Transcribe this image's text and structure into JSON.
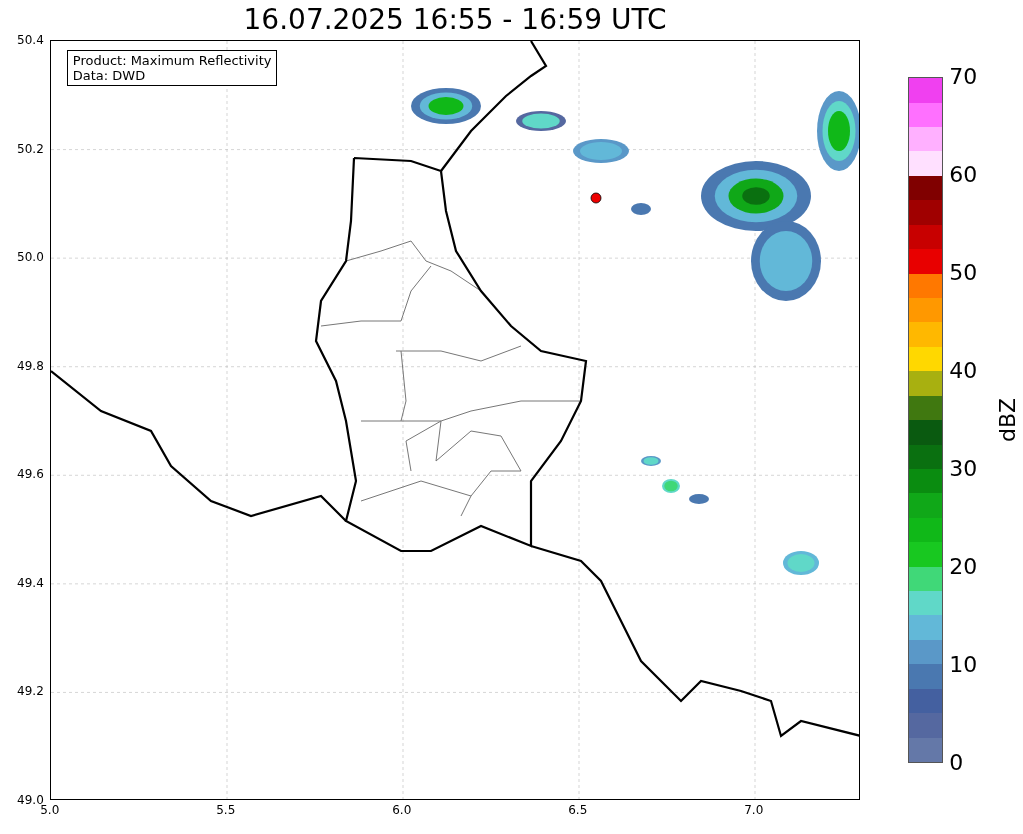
{
  "title": "16.07.2025 16:55 - 16:59 UTC",
  "info_box": [
    "Product: Maximum Reflectivity",
    "Data: DWD"
  ],
  "x_ticks": [
    "5.0",
    "5.5",
    "6.0",
    "6.5",
    "7.0"
  ],
  "y_ticks": [
    "50.4",
    "50.2",
    "50.0",
    "49.8",
    "49.6",
    "49.4",
    "49.2",
    "49.0"
  ],
  "colorbar": {
    "label": "dBZ",
    "ticks": [
      "70",
      "60",
      "50",
      "40",
      "30",
      "20",
      "10",
      "0"
    ],
    "bands": [
      {
        "color": "#6478a8"
      },
      {
        "color": "#5568a0"
      },
      {
        "color": "#4460a0"
      },
      {
        "color": "#4a78b0"
      },
      {
        "color": "#5a98c8"
      },
      {
        "color": "#62b8d8"
      },
      {
        "color": "#60d8c8"
      },
      {
        "color": "#40d878"
      },
      {
        "color": "#18c820"
      },
      {
        "color": "#10b818"
      },
      {
        "color": "#10a818"
      },
      {
        "color": "#0a8c10"
      },
      {
        "color": "#0a7010"
      },
      {
        "color": "#0a5a10"
      },
      {
        "color": "#407810"
      },
      {
        "color": "#a8b010"
      },
      {
        "color": "#ffd800"
      },
      {
        "color": "#ffb800"
      },
      {
        "color": "#ff9800"
      },
      {
        "color": "#ff7800"
      },
      {
        "color": "#e80000"
      },
      {
        "color": "#c80000"
      },
      {
        "color": "#a00000"
      },
      {
        "color": "#800000"
      },
      {
        "color": "#ffe0ff"
      },
      {
        "color": "#ffb0ff"
      },
      {
        "color": "#ff70ff"
      },
      {
        "color": "#f040f0"
      }
    ]
  }
}
